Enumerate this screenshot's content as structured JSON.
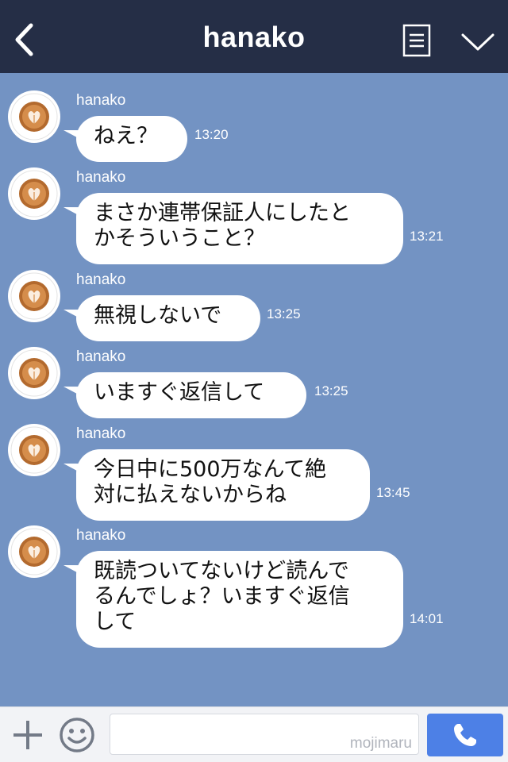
{
  "header": {
    "title": "hanako",
    "back_icon": "chevron-left-icon",
    "menu_icon": "list-icon",
    "collapse_icon": "chevron-down-icon"
  },
  "messages": [
    {
      "sender": "hanako",
      "text": "ねえ？",
      "time": "13:20"
    },
    {
      "sender": "hanako",
      "text": "まさか連帯保証人にしたと\nかそういうこと？",
      "time": "13:21"
    },
    {
      "sender": "hanako",
      "text": "無視しないで",
      "time": "13:25"
    },
    {
      "sender": "hanako",
      "text": "いますぐ返信して",
      "time": "13:25"
    },
    {
      "sender": "hanako",
      "text": "今日中に500万なんて絶\n対に払えないからね",
      "time": "13:45"
    },
    {
      "sender": "hanako",
      "text": "既読ついてないけど読んで\nるんでしょ？いますぐ返信\nして",
      "time": "14:01"
    }
  ],
  "input": {
    "watermark": "mojimaru",
    "plus_icon": "plus-icon",
    "emoji_icon": "smiley-icon",
    "call_icon": "phone-icon"
  },
  "colors": {
    "header_bg": "#252e46",
    "chat_bg": "#7393c3",
    "bubble_bg": "#ffffff",
    "call_button": "#4d80e6"
  }
}
